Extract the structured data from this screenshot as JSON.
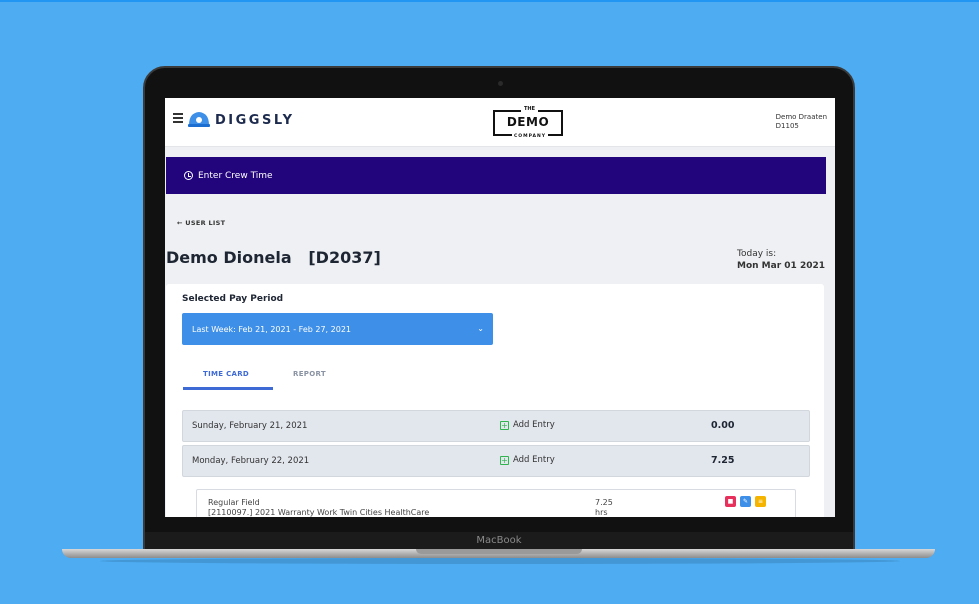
{
  "header": {
    "logo_text": "DIGGSLY",
    "company": {
      "top": "THE",
      "main": "DEMO",
      "bottom": "COMPANY"
    },
    "user": {
      "name": "Demo Draaten",
      "id": "D1105"
    }
  },
  "crew_bar": {
    "label": "Enter Crew Time"
  },
  "back_link": "← USER LIST",
  "employee": {
    "title": "Demo Dionela   [D2037]"
  },
  "today": {
    "label": "Today is:",
    "date": "Mon Mar 01 2021"
  },
  "pay_period": {
    "label": "Selected Pay Period",
    "selected": "Last Week: Feb 21, 2021 - Feb 27, 2021"
  },
  "tabs": [
    {
      "label": "TIME CARD",
      "active": true
    },
    {
      "label": "REPORT",
      "active": false
    }
  ],
  "days": [
    {
      "date": "Sunday, February 21, 2021",
      "add_label": "Add Entry",
      "total": "0.00"
    },
    {
      "date": "Monday, February 22, 2021",
      "add_label": "Add Entry",
      "total": "7.25"
    }
  ],
  "entry": {
    "type": "Regular Field",
    "description": "[2110097.] 2021 Warranty Work Twin Cities HealthCare",
    "hours": "7.25",
    "hours_unit": "hrs"
  },
  "device_label": "MacBook",
  "colors": {
    "background": "#4dacf2",
    "crew_bar": "#22047d",
    "select": "#3e8fe8",
    "tab_active": "#3e6ad6",
    "add_icon": "#2fb44e",
    "delete": "#e8305d",
    "edit": "#3e8fe8",
    "more": "#f5b400"
  },
  "icons": [
    "menu-icon",
    "clock-icon",
    "chevron-down-icon",
    "plus-square-icon",
    "trash-icon",
    "pencil-icon",
    "list-icon"
  ]
}
